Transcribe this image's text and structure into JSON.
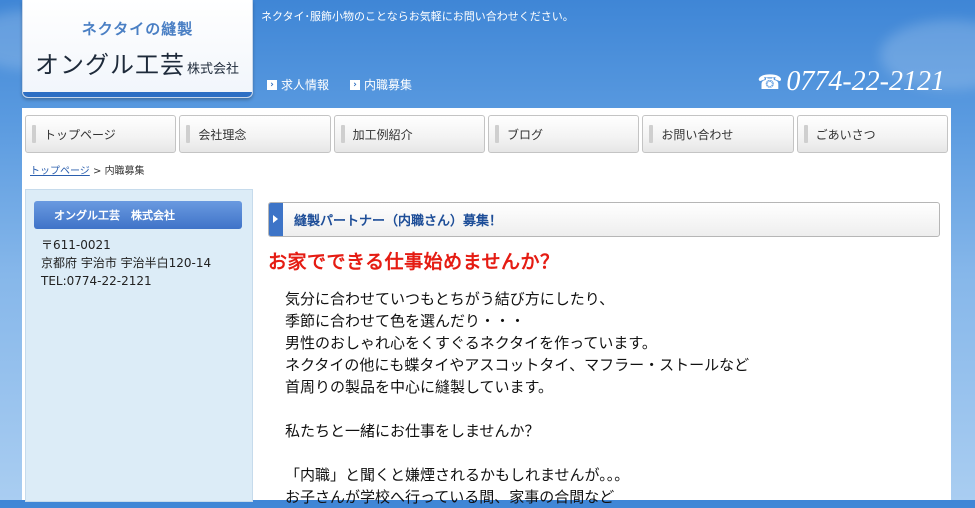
{
  "header": {
    "logo_sub": "ネクタイの縫製",
    "logo_main": "オングル工芸",
    "logo_suffix": "株式会社",
    "tagline": "ネクタイ･服飾小物のことならお気軽にお問い合わせください。",
    "links": [
      {
        "label": "求人情報"
      },
      {
        "label": "内職募集"
      }
    ],
    "phone_icon": "☎",
    "phone": "0774-22-2121"
  },
  "nav": {
    "items": [
      {
        "label": "トップページ"
      },
      {
        "label": "会社理念"
      },
      {
        "label": "加工例紹介"
      },
      {
        "label": "ブログ"
      },
      {
        "label": "お問い合わせ"
      },
      {
        "label": "ごあいさつ"
      }
    ]
  },
  "breadcrumb": {
    "home": "トップページ",
    "separator": " > ",
    "current": "内職募集"
  },
  "sidebar": {
    "title": "オングル工芸　株式会社",
    "postal": "〒611-0021",
    "address": "京都府 宇治市 宇治半白120-14",
    "tel": "TEL:0774-22-2121"
  },
  "content": {
    "section_title": "縫製パートナー（内職さん）募集！",
    "headline": "お家でできる仕事始めませんか？",
    "paragraph1": [
      "気分に合わせていつもとちがう結び方にしたり、",
      "季節に合わせて色を選んだり・・・",
      "男性のおしゃれ心をくすぐるネクタイを作っています。",
      "ネクタイの他にも蝶タイやアスコットタイ、マフラー・ストールなど",
      "首周りの製品を中心に縫製しています。"
    ],
    "paragraph2": "私たちと一緒にお仕事をしませんか？",
    "paragraph3": [
      "「内職」と聞くと嫌煙されるかもしれませんが。。。",
      "お子さんが学校へ行っている間、家事の合間など"
    ]
  },
  "colors": {
    "accent_blue": "#3d74c7",
    "headline_red": "#e51c13",
    "sidebar_bg": "#dcecf7"
  }
}
